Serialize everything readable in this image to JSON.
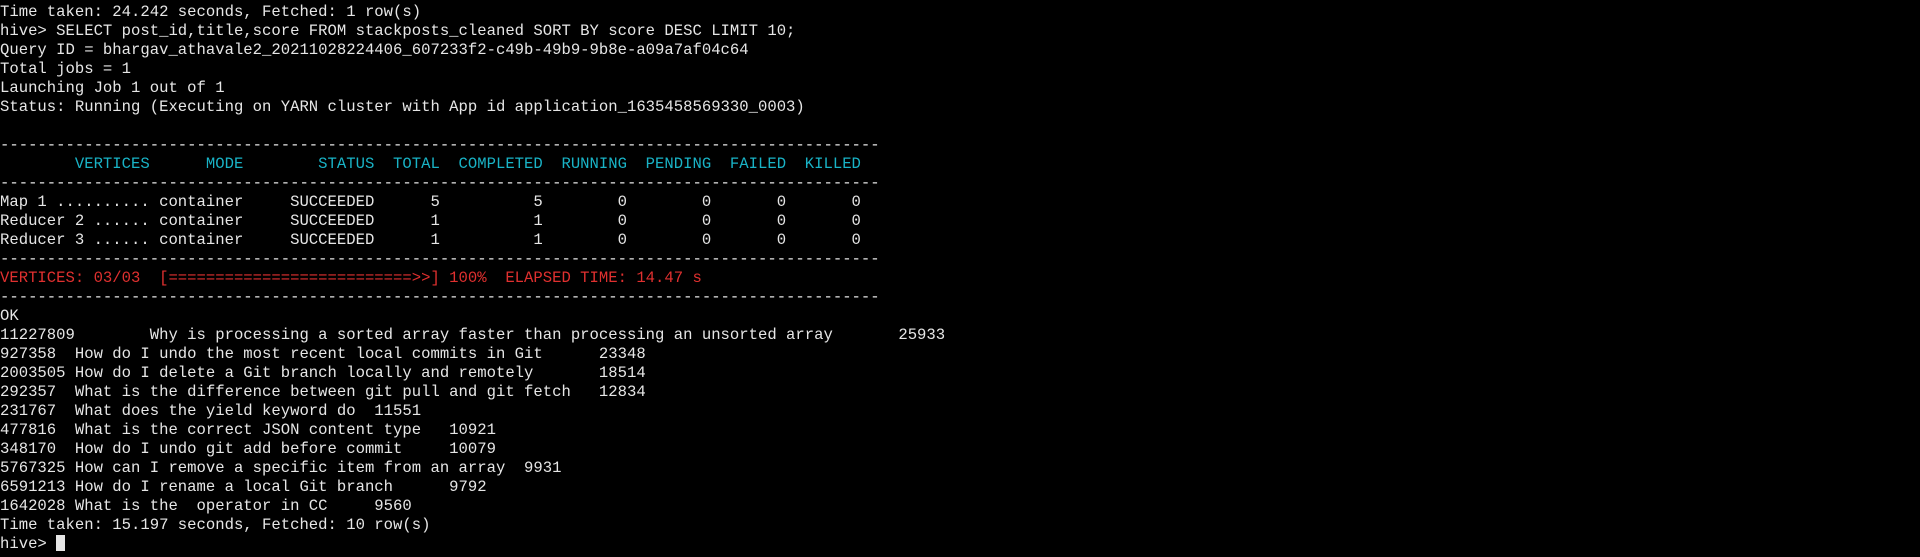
{
  "terminal": {
    "lines": [
      {
        "text": "Time taken: 24.242 seconds, Fetched: 1 row(s)",
        "style": "white"
      },
      {
        "text": "hive> SELECT post_id,title,score FROM stackposts_cleaned SORT BY score DESC LIMIT 10;",
        "style": "white"
      },
      {
        "text": "Query ID = bhargav_athavale2_20211028224406_607233f2-c49b-49b9-9b8e-a09a7af04c64",
        "style": "white"
      },
      {
        "text": "Total jobs = 1",
        "style": "white"
      },
      {
        "text": "Launching Job 1 out of 1",
        "style": "white"
      },
      {
        "text": "Status: Running (Executing on YARN cluster with App id application_1635458569330_0003)",
        "style": "white"
      },
      {
        "text": "",
        "style": "white"
      },
      {
        "text": "----------------------------------------------------------------------------------------------",
        "style": "white"
      },
      {
        "text": "        VERTICES      MODE        STATUS  TOTAL  COMPLETED  RUNNING  PENDING  FAILED  KILLED",
        "style": "cyan"
      },
      {
        "text": "----------------------------------------------------------------------------------------------",
        "style": "white"
      },
      {
        "text": "Map 1 .......... container     SUCCEEDED      5          5        0        0       0       0",
        "style": "white"
      },
      {
        "text": "Reducer 2 ...... container     SUCCEEDED      1          1        0        0       0       0",
        "style": "white"
      },
      {
        "text": "Reducer 3 ...... container     SUCCEEDED      1          1        0        0       0       0",
        "style": "white"
      },
      {
        "text": "----------------------------------------------------------------------------------------------",
        "style": "white"
      },
      {
        "text": "VERTICES: 03/03  [==========================>>] 100%  ELAPSED TIME: 14.47 s",
        "style": "red"
      },
      {
        "text": "----------------------------------------------------------------------------------------------",
        "style": "white"
      },
      {
        "text": "OK",
        "style": "white"
      },
      {
        "text": "11227809        Why is processing a sorted array faster than processing an unsorted array       25933",
        "style": "white"
      },
      {
        "text": "927358  How do I undo the most recent local commits in Git      23348",
        "style": "white"
      },
      {
        "text": "2003505 How do I delete a Git branch locally and remotely       18514",
        "style": "white"
      },
      {
        "text": "292357  What is the difference between git pull and git fetch   12834",
        "style": "white"
      },
      {
        "text": "231767  What does the yield keyword do  11551",
        "style": "white"
      },
      {
        "text": "477816  What is the correct JSON content type   10921",
        "style": "white"
      },
      {
        "text": "348170  How do I undo git add before commit     10079",
        "style": "white"
      },
      {
        "text": "5767325 How can I remove a specific item from an array  9931",
        "style": "white"
      },
      {
        "text": "6591213 How do I rename a local Git branch      9792",
        "style": "white"
      },
      {
        "text": "1642028 What is the  operator in CC     9560",
        "style": "white"
      },
      {
        "text": "Time taken: 15.197 seconds, Fetched: 10 row(s)",
        "style": "white"
      }
    ],
    "prompt": "hive> "
  },
  "colors": {
    "background": "#000000",
    "foreground": "#e6e6e6",
    "header_cyan": "#19b3c6",
    "progress_red": "#e0302f"
  }
}
